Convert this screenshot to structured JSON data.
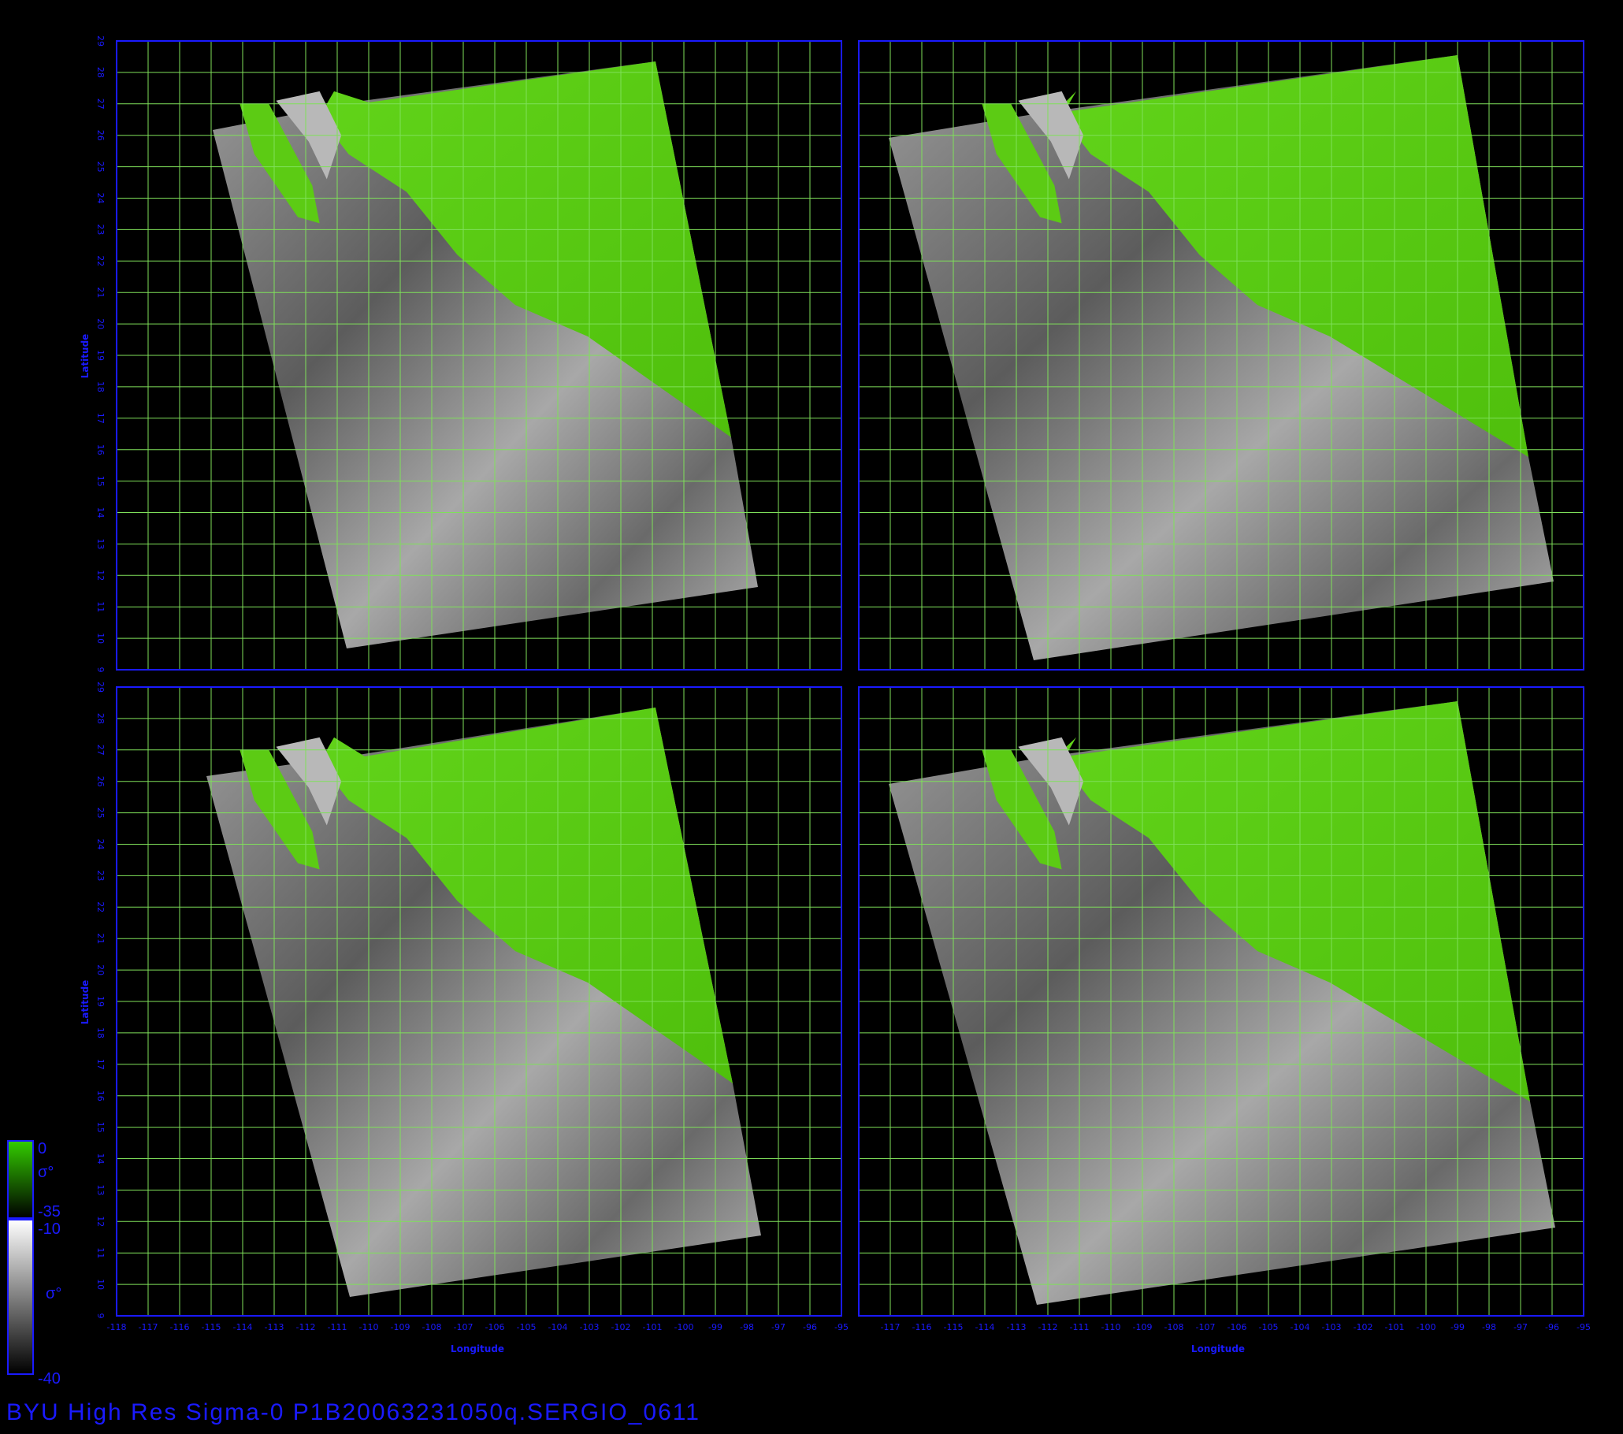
{
  "title": "BYU  High  Res  Sigma-0  P1B20063231050q.SERGIO_0611",
  "axes": {
    "xlabel": "Longitude",
    "ylabel": "Latitude",
    "lon_range": [
      -118,
      -95
    ],
    "lat_range": [
      9,
      29
    ],
    "lon_ticks_left": [
      "-118",
      "-117",
      "-116",
      "-115",
      "-114",
      "-113",
      "-112",
      "-111",
      "-110",
      "-109",
      "-108",
      "-107",
      "-106",
      "-105",
      "-104",
      "-103",
      "-102",
      "-101",
      "-100",
      "-99",
      "-98",
      "-97",
      "-96",
      "-95"
    ],
    "lon_ticks_right": [
      "-117",
      "-116",
      "-115",
      "-114",
      "-113",
      "-112",
      "-111",
      "-110",
      "-109",
      "-108",
      "-107",
      "-106",
      "-105",
      "-104",
      "-103",
      "-102",
      "-101",
      "-100",
      "-99",
      "-98",
      "-97",
      "-96",
      "-95"
    ],
    "lat_ticks": [
      "9",
      "10",
      "11",
      "12",
      "13",
      "14",
      "15",
      "16",
      "17",
      "18",
      "19",
      "20",
      "21",
      "22",
      "23",
      "24",
      "25",
      "26",
      "27",
      "28",
      "29"
    ]
  },
  "colorbars": {
    "land": {
      "top": "0",
      "symbol": "σ°",
      "bottom": "-35",
      "colors": [
        "#33cc00",
        "#000000"
      ]
    },
    "ocean": {
      "top": "-10",
      "symbol": "σ°",
      "bottom": "-40",
      "colors": [
        "#ffffff",
        "#000000"
      ]
    }
  },
  "colors": {
    "axis": "#1a1aff",
    "grid": "#7fe05a",
    "land": "#55c810",
    "ocean": "#8a8a8a"
  }
}
